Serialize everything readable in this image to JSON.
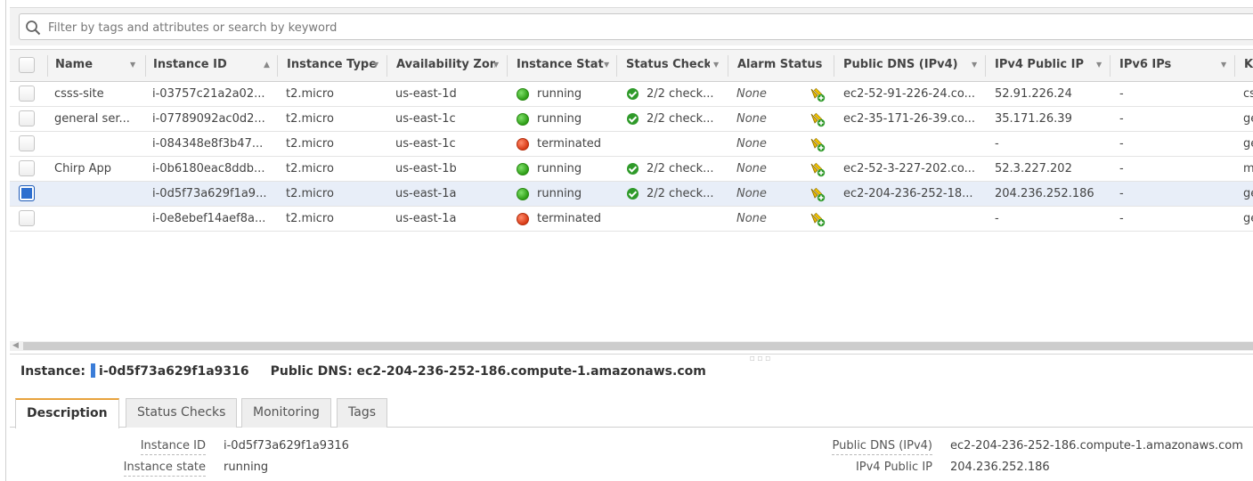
{
  "search": {
    "placeholder": "Filter by tags and attributes or search by keyword"
  },
  "columns": [
    "Name",
    "Instance ID",
    "Instance Type",
    "Availability Zone",
    "Instance State",
    "Status Checks",
    "Alarm Status",
    "Public DNS (IPv4)",
    "IPv4 Public IP",
    "IPv6 IPs",
    "K"
  ],
  "rows": [
    {
      "name": "csss-site",
      "id": "i-03757c21a2a02...",
      "type": "t2.micro",
      "az": "us-east-1d",
      "state": "running",
      "state_color": "green",
      "checks": "2/2 check...",
      "alarm": "None",
      "dns": "ec2-52-91-226-24.co...",
      "ip": "52.91.226.24",
      "ipv6": "-",
      "k": "cs"
    },
    {
      "name": "general ser...",
      "id": "i-07789092ac0d2...",
      "type": "t2.micro",
      "az": "us-east-1c",
      "state": "running",
      "state_color": "green",
      "checks": "2/2 check...",
      "alarm": "None",
      "dns": "ec2-35-171-26-39.co...",
      "ip": "35.171.26.39",
      "ipv6": "-",
      "k": "ge"
    },
    {
      "name": "",
      "id": "i-084348e8f3b47...",
      "type": "t2.micro",
      "az": "us-east-1c",
      "state": "terminated",
      "state_color": "red",
      "checks": "",
      "alarm": "None",
      "dns": "",
      "ip": "-",
      "ipv6": "-",
      "k": "ge"
    },
    {
      "name": "Chirp App",
      "id": "i-0b6180eac8ddb...",
      "type": "t2.micro",
      "az": "us-east-1b",
      "state": "running",
      "state_color": "green",
      "checks": "2/2 check...",
      "alarm": "None",
      "dns": "ec2-52-3-227-202.co...",
      "ip": "52.3.227.202",
      "ipv6": "-",
      "k": "m"
    },
    {
      "name": "",
      "id": "i-0d5f73a629f1a9...",
      "type": "t2.micro",
      "az": "us-east-1a",
      "state": "running",
      "state_color": "green",
      "checks": "2/2 check...",
      "alarm": "None",
      "dns": "ec2-204-236-252-18...",
      "ip": "204.236.252.186",
      "ipv6": "-",
      "k": "ge",
      "selected": true
    },
    {
      "name": "",
      "id": "i-0e8ebef14aef8a...",
      "type": "t2.micro",
      "az": "us-east-1a",
      "state": "terminated",
      "state_color": "red",
      "checks": "",
      "alarm": "None",
      "dns": "",
      "ip": "-",
      "ipv6": "-",
      "k": "ge"
    }
  ],
  "detail": {
    "instance_label": "Instance:",
    "instance_id": "i-0d5f73a629f1a9316",
    "dns_label": "Public DNS:",
    "dns_value": "ec2-204-236-252-186.compute-1.amazonaws.com",
    "tabs": [
      "Description",
      "Status Checks",
      "Monitoring",
      "Tags"
    ],
    "fields_left": [
      {
        "label": "Instance ID",
        "value": "i-0d5f73a629f1a9316"
      },
      {
        "label": "Instance state",
        "value": "running"
      }
    ],
    "fields_right": [
      {
        "label": "Public DNS (IPv4)",
        "value": "ec2-204-236-252-186.compute-1.amazonaws.com"
      },
      {
        "label": "IPv4 Public IP",
        "value": "204.236.252.186"
      }
    ]
  },
  "colors": {
    "selected_row": "#e8eef8",
    "active_tab_accent": "#e8a33d",
    "running": "#2e9e16",
    "terminated": "#d83a16"
  },
  "icons": {
    "search": "search-icon",
    "alarm": "alarm-add-icon",
    "check": "check-circle-icon"
  }
}
